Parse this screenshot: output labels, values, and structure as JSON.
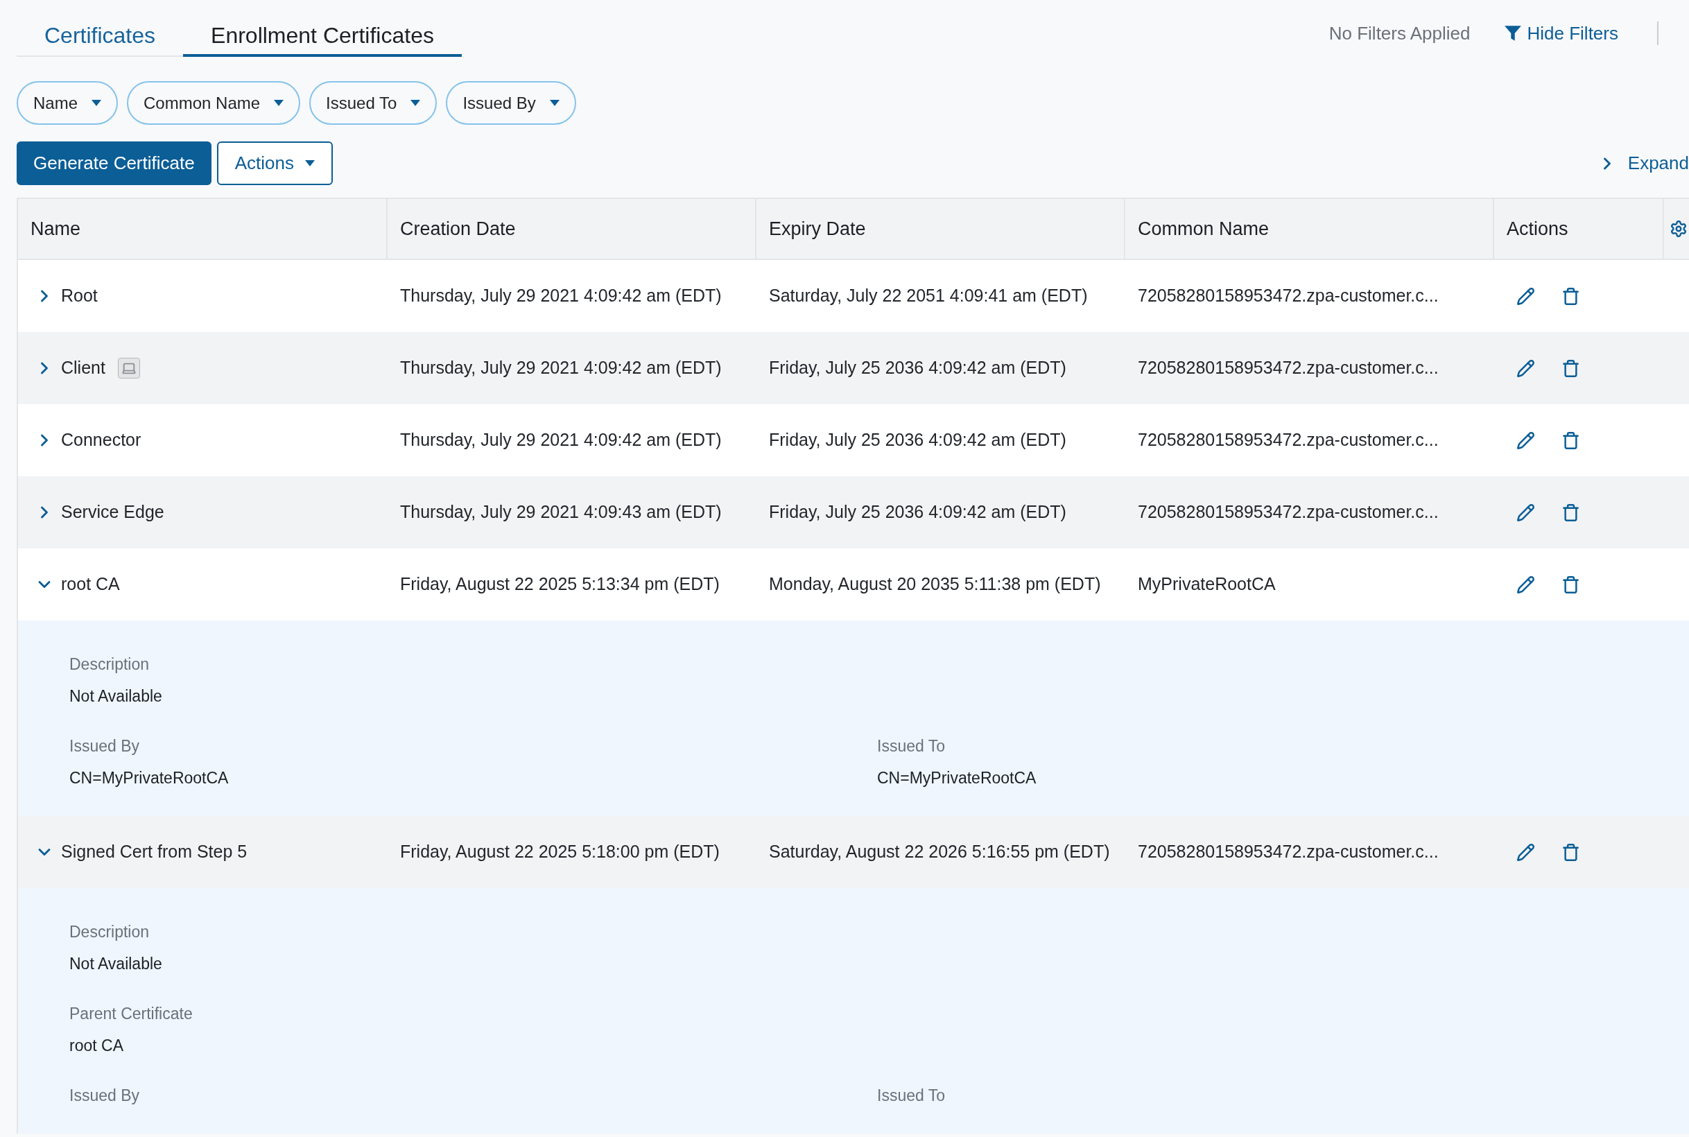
{
  "tabs": [
    {
      "label": "Certificates",
      "selected": false
    },
    {
      "label": "Enrollment Certificates",
      "selected": true
    }
  ],
  "filter_status": "No Filters Applied",
  "hide_filters": "Hide Filters",
  "filters": [
    {
      "label": "Name"
    },
    {
      "label": "Common Name"
    },
    {
      "label": "Issued To"
    },
    {
      "label": "Issued By"
    }
  ],
  "toolbar": {
    "primary": "Generate Certificate",
    "actions": "Actions",
    "expand": "Expand"
  },
  "table": {
    "columns": [
      "Name",
      "Creation Date",
      "Expiry Date",
      "Common Name",
      "Actions"
    ],
    "rows": [
      {
        "name": "Root",
        "expanded": false,
        "device_icon": false,
        "creation": "Thursday, July 29 2021 4:09:42 am (EDT)",
        "expiry": "Saturday, July 22 2051 4:09:41 am (EDT)",
        "common_name": "72058280158953472.zpa-customer.c..."
      },
      {
        "name": "Client",
        "expanded": false,
        "device_icon": true,
        "creation": "Thursday, July 29 2021 4:09:42 am (EDT)",
        "expiry": "Friday, July 25 2036 4:09:42 am (EDT)",
        "common_name": "72058280158953472.zpa-customer.c..."
      },
      {
        "name": "Connector",
        "expanded": false,
        "device_icon": false,
        "creation": "Thursday, July 29 2021 4:09:42 am (EDT)",
        "expiry": "Friday, July 25 2036 4:09:42 am (EDT)",
        "common_name": "72058280158953472.zpa-customer.c..."
      },
      {
        "name": "Service Edge",
        "expanded": false,
        "device_icon": false,
        "creation": "Thursday, July 29 2021 4:09:43 am (EDT)",
        "expiry": "Friday, July 25 2036 4:09:42 am (EDT)",
        "common_name": "72058280158953472.zpa-customer.c..."
      },
      {
        "name": "root CA",
        "expanded": true,
        "device_icon": false,
        "creation": "Friday, August 22 2025 5:13:34 pm (EDT)",
        "expiry": "Monday, August 20 2035 5:11:38 pm (EDT)",
        "common_name": "MyPrivateRootCA",
        "details": [
          [
            {
              "label": "Description",
              "value": "Not Available"
            }
          ],
          [
            {
              "label": "Issued By",
              "value": "CN=MyPrivateRootCA"
            },
            {
              "label": "Issued To",
              "value": "CN=MyPrivateRootCA"
            }
          ]
        ]
      },
      {
        "name": "Signed Cert from Step 5",
        "expanded": true,
        "device_icon": false,
        "creation": "Friday, August 22 2025 5:18:00 pm (EDT)",
        "expiry": "Saturday, August 22 2026 5:16:55 pm (EDT)",
        "common_name": "72058280158953472.zpa-customer.c...",
        "details": [
          [
            {
              "label": "Description",
              "value": "Not Available"
            }
          ],
          [
            {
              "label": "Parent Certificate",
              "value": "root CA"
            }
          ],
          [
            {
              "label": "Issued By"
            },
            {
              "label": "Issued To"
            }
          ]
        ]
      }
    ]
  }
}
